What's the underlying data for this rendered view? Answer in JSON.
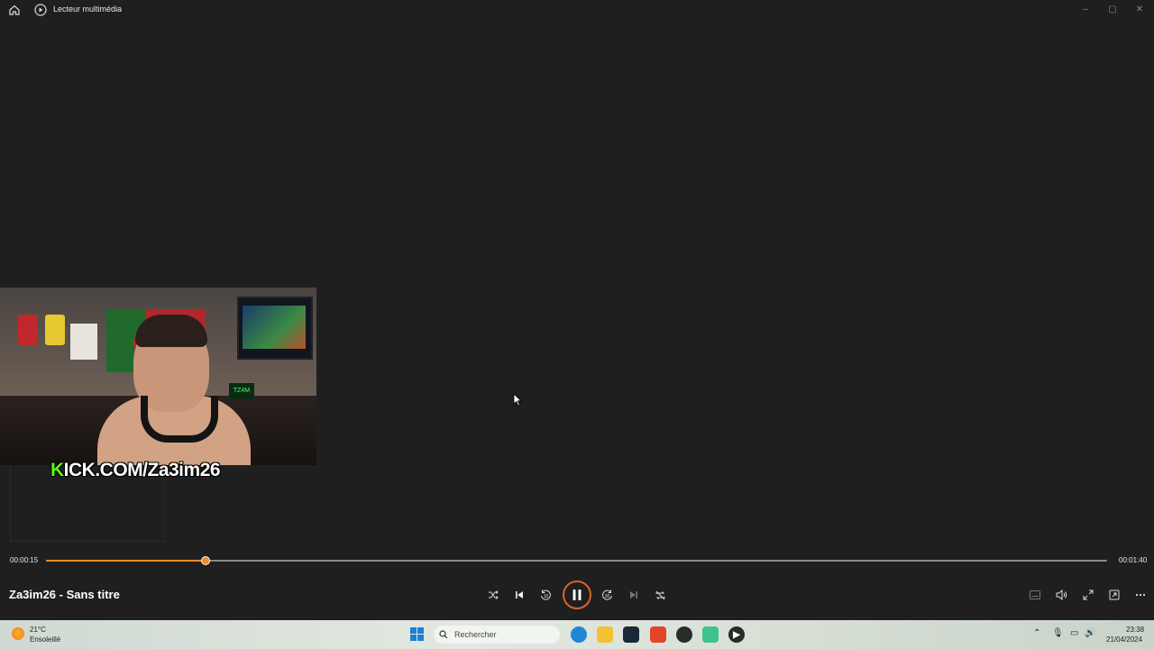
{
  "window": {
    "title": "Lecteur multimédia"
  },
  "video": {
    "overlay_text_prefix": "K",
    "overlay_text": "KICK.COM/Za3im26",
    "sign_text": "TZ4M"
  },
  "playback": {
    "current_time": "00:00:15",
    "total_time": "00:01:40",
    "progress": 0.15,
    "media_title": "Za3im26 - Sans titre",
    "state": "playing"
  },
  "icons": {
    "shuffle": "shuffle-icon",
    "previous": "previous-icon",
    "rewind": "rewind-10-icon",
    "pause": "pause-icon",
    "forward": "forward-30-icon",
    "next": "next-icon",
    "repeat": "repeat-off-icon",
    "subtitles": "subtitles-icon",
    "volume": "volume-icon",
    "fullscreen": "fullscreen-icon",
    "miniplayer": "miniplayer-icon",
    "more": "more-icon"
  },
  "taskbar": {
    "weather": {
      "temp": "21°C",
      "condition": "Ensoleillé"
    },
    "search_placeholder": "Rechercher",
    "clock": {
      "time": "23:38",
      "date": "21/04/2024"
    }
  },
  "colors": {
    "accent": "#f08a2c",
    "background": "#1f1f1f",
    "kick_green": "#53fc18"
  }
}
